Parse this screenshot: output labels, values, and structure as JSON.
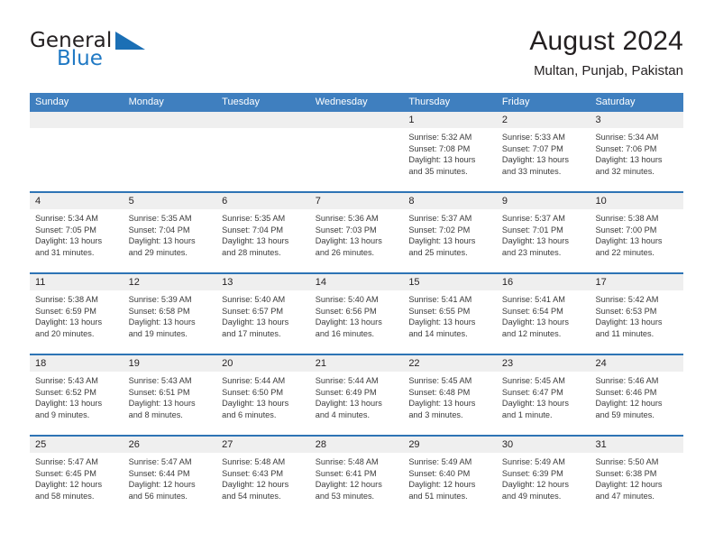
{
  "brand": {
    "name_part1": "General",
    "name_part2": "Blue",
    "flag_icon": "triangle-flag-icon",
    "accent_color": "#1b6fb5"
  },
  "header": {
    "title": "August 2024",
    "subtitle": "Multan, Punjab, Pakistan"
  },
  "theme": {
    "header_bar_color": "#3f7fbf",
    "row_divider_color": "#2e74b5",
    "day_band_color": "#efefef",
    "text_color": "#231f20"
  },
  "weekdays": [
    "Sunday",
    "Monday",
    "Tuesday",
    "Wednesday",
    "Thursday",
    "Friday",
    "Saturday"
  ],
  "weeks": [
    [
      {
        "day": "",
        "sunrise": "",
        "sunset": "",
        "daylight_line1": "",
        "daylight_line2": ""
      },
      {
        "day": "",
        "sunrise": "",
        "sunset": "",
        "daylight_line1": "",
        "daylight_line2": ""
      },
      {
        "day": "",
        "sunrise": "",
        "sunset": "",
        "daylight_line1": "",
        "daylight_line2": ""
      },
      {
        "day": "",
        "sunrise": "",
        "sunset": "",
        "daylight_line1": "",
        "daylight_line2": ""
      },
      {
        "day": "1",
        "sunrise": "Sunrise: 5:32 AM",
        "sunset": "Sunset: 7:08 PM",
        "daylight_line1": "Daylight: 13 hours",
        "daylight_line2": "and 35 minutes."
      },
      {
        "day": "2",
        "sunrise": "Sunrise: 5:33 AM",
        "sunset": "Sunset: 7:07 PM",
        "daylight_line1": "Daylight: 13 hours",
        "daylight_line2": "and 33 minutes."
      },
      {
        "day": "3",
        "sunrise": "Sunrise: 5:34 AM",
        "sunset": "Sunset: 7:06 PM",
        "daylight_line1": "Daylight: 13 hours",
        "daylight_line2": "and 32 minutes."
      }
    ],
    [
      {
        "day": "4",
        "sunrise": "Sunrise: 5:34 AM",
        "sunset": "Sunset: 7:05 PM",
        "daylight_line1": "Daylight: 13 hours",
        "daylight_line2": "and 31 minutes."
      },
      {
        "day": "5",
        "sunrise": "Sunrise: 5:35 AM",
        "sunset": "Sunset: 7:04 PM",
        "daylight_line1": "Daylight: 13 hours",
        "daylight_line2": "and 29 minutes."
      },
      {
        "day": "6",
        "sunrise": "Sunrise: 5:35 AM",
        "sunset": "Sunset: 7:04 PM",
        "daylight_line1": "Daylight: 13 hours",
        "daylight_line2": "and 28 minutes."
      },
      {
        "day": "7",
        "sunrise": "Sunrise: 5:36 AM",
        "sunset": "Sunset: 7:03 PM",
        "daylight_line1": "Daylight: 13 hours",
        "daylight_line2": "and 26 minutes."
      },
      {
        "day": "8",
        "sunrise": "Sunrise: 5:37 AM",
        "sunset": "Sunset: 7:02 PM",
        "daylight_line1": "Daylight: 13 hours",
        "daylight_line2": "and 25 minutes."
      },
      {
        "day": "9",
        "sunrise": "Sunrise: 5:37 AM",
        "sunset": "Sunset: 7:01 PM",
        "daylight_line1": "Daylight: 13 hours",
        "daylight_line2": "and 23 minutes."
      },
      {
        "day": "10",
        "sunrise": "Sunrise: 5:38 AM",
        "sunset": "Sunset: 7:00 PM",
        "daylight_line1": "Daylight: 13 hours",
        "daylight_line2": "and 22 minutes."
      }
    ],
    [
      {
        "day": "11",
        "sunrise": "Sunrise: 5:38 AM",
        "sunset": "Sunset: 6:59 PM",
        "daylight_line1": "Daylight: 13 hours",
        "daylight_line2": "and 20 minutes."
      },
      {
        "day": "12",
        "sunrise": "Sunrise: 5:39 AM",
        "sunset": "Sunset: 6:58 PM",
        "daylight_line1": "Daylight: 13 hours",
        "daylight_line2": "and 19 minutes."
      },
      {
        "day": "13",
        "sunrise": "Sunrise: 5:40 AM",
        "sunset": "Sunset: 6:57 PM",
        "daylight_line1": "Daylight: 13 hours",
        "daylight_line2": "and 17 minutes."
      },
      {
        "day": "14",
        "sunrise": "Sunrise: 5:40 AM",
        "sunset": "Sunset: 6:56 PM",
        "daylight_line1": "Daylight: 13 hours",
        "daylight_line2": "and 16 minutes."
      },
      {
        "day": "15",
        "sunrise": "Sunrise: 5:41 AM",
        "sunset": "Sunset: 6:55 PM",
        "daylight_line1": "Daylight: 13 hours",
        "daylight_line2": "and 14 minutes."
      },
      {
        "day": "16",
        "sunrise": "Sunrise: 5:41 AM",
        "sunset": "Sunset: 6:54 PM",
        "daylight_line1": "Daylight: 13 hours",
        "daylight_line2": "and 12 minutes."
      },
      {
        "day": "17",
        "sunrise": "Sunrise: 5:42 AM",
        "sunset": "Sunset: 6:53 PM",
        "daylight_line1": "Daylight: 13 hours",
        "daylight_line2": "and 11 minutes."
      }
    ],
    [
      {
        "day": "18",
        "sunrise": "Sunrise: 5:43 AM",
        "sunset": "Sunset: 6:52 PM",
        "daylight_line1": "Daylight: 13 hours",
        "daylight_line2": "and 9 minutes."
      },
      {
        "day": "19",
        "sunrise": "Sunrise: 5:43 AM",
        "sunset": "Sunset: 6:51 PM",
        "daylight_line1": "Daylight: 13 hours",
        "daylight_line2": "and 8 minutes."
      },
      {
        "day": "20",
        "sunrise": "Sunrise: 5:44 AM",
        "sunset": "Sunset: 6:50 PM",
        "daylight_line1": "Daylight: 13 hours",
        "daylight_line2": "and 6 minutes."
      },
      {
        "day": "21",
        "sunrise": "Sunrise: 5:44 AM",
        "sunset": "Sunset: 6:49 PM",
        "daylight_line1": "Daylight: 13 hours",
        "daylight_line2": "and 4 minutes."
      },
      {
        "day": "22",
        "sunrise": "Sunrise: 5:45 AM",
        "sunset": "Sunset: 6:48 PM",
        "daylight_line1": "Daylight: 13 hours",
        "daylight_line2": "and 3 minutes."
      },
      {
        "day": "23",
        "sunrise": "Sunrise: 5:45 AM",
        "sunset": "Sunset: 6:47 PM",
        "daylight_line1": "Daylight: 13 hours",
        "daylight_line2": "and 1 minute."
      },
      {
        "day": "24",
        "sunrise": "Sunrise: 5:46 AM",
        "sunset": "Sunset: 6:46 PM",
        "daylight_line1": "Daylight: 12 hours",
        "daylight_line2": "and 59 minutes."
      }
    ],
    [
      {
        "day": "25",
        "sunrise": "Sunrise: 5:47 AM",
        "sunset": "Sunset: 6:45 PM",
        "daylight_line1": "Daylight: 12 hours",
        "daylight_line2": "and 58 minutes."
      },
      {
        "day": "26",
        "sunrise": "Sunrise: 5:47 AM",
        "sunset": "Sunset: 6:44 PM",
        "daylight_line1": "Daylight: 12 hours",
        "daylight_line2": "and 56 minutes."
      },
      {
        "day": "27",
        "sunrise": "Sunrise: 5:48 AM",
        "sunset": "Sunset: 6:43 PM",
        "daylight_line1": "Daylight: 12 hours",
        "daylight_line2": "and 54 minutes."
      },
      {
        "day": "28",
        "sunrise": "Sunrise: 5:48 AM",
        "sunset": "Sunset: 6:41 PM",
        "daylight_line1": "Daylight: 12 hours",
        "daylight_line2": "and 53 minutes."
      },
      {
        "day": "29",
        "sunrise": "Sunrise: 5:49 AM",
        "sunset": "Sunset: 6:40 PM",
        "daylight_line1": "Daylight: 12 hours",
        "daylight_line2": "and 51 minutes."
      },
      {
        "day": "30",
        "sunrise": "Sunrise: 5:49 AM",
        "sunset": "Sunset: 6:39 PM",
        "daylight_line1": "Daylight: 12 hours",
        "daylight_line2": "and 49 minutes."
      },
      {
        "day": "31",
        "sunrise": "Sunrise: 5:50 AM",
        "sunset": "Sunset: 6:38 PM",
        "daylight_line1": "Daylight: 12 hours",
        "daylight_line2": "and 47 minutes."
      }
    ]
  ]
}
